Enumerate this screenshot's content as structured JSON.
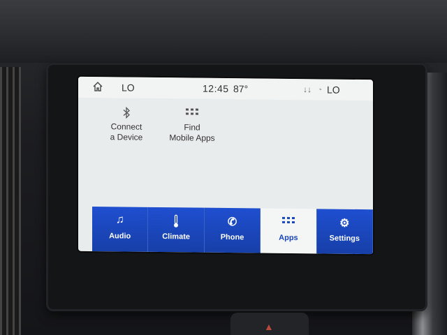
{
  "status": {
    "source_left": "LO",
    "time": "12:45",
    "temperature": "87°",
    "source_right": "LO"
  },
  "tiles": [
    {
      "label_line1": "Connect",
      "label_line2": "a Device",
      "icon": "bluetooth-icon"
    },
    {
      "label_line1": "Find",
      "label_line2": "Mobile Apps",
      "icon": "apps-grid-icon"
    }
  ],
  "nav": [
    {
      "label": "Audio",
      "icon": "music-note-icon"
    },
    {
      "label": "Climate",
      "icon": "thermometer-icon"
    },
    {
      "label": "Phone",
      "icon": "phone-icon"
    },
    {
      "label": "Apps",
      "icon": "apps-grid-icon",
      "active": true
    },
    {
      "label": "Settings",
      "icon": "gear-icon"
    }
  ],
  "colors": {
    "nav_blue": "#1f4fd0",
    "screen_bg": "#e9ecec"
  }
}
